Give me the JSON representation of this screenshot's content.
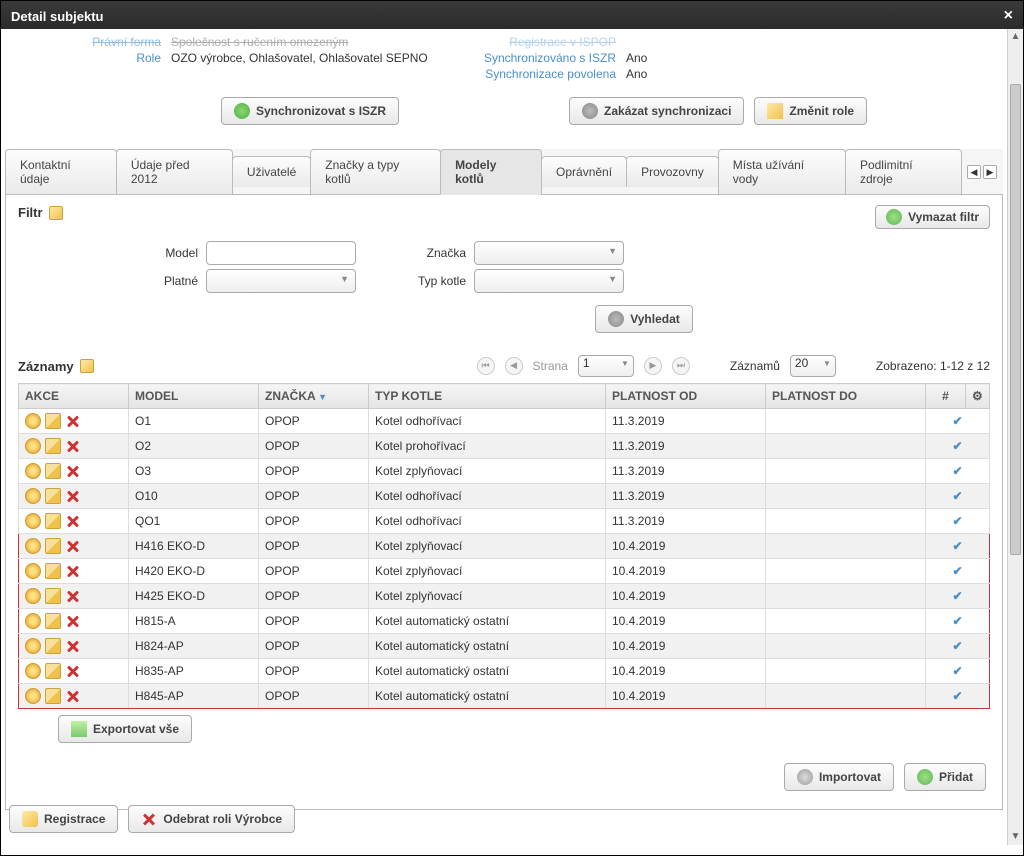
{
  "window": {
    "title": "Detail subjektu"
  },
  "header": {
    "left": [
      {
        "label": "Právní forma",
        "value": "Společnost s ručením omezeným",
        "truncated": true
      },
      {
        "label": "Role",
        "value": "OZO výrobce, Ohlašovatel, Ohlašovatel SEPNO"
      }
    ],
    "right": [
      {
        "label": "Registrace v ISPOP",
        "value": "",
        "truncated": true
      },
      {
        "label": "Synchronizováno s ISZR",
        "value": "Ano"
      },
      {
        "label": "Synchronizace povolena",
        "value": "Ano"
      }
    ]
  },
  "buttons": {
    "sync": "Synchronizovat s ISZR",
    "block": "Zakázat synchronizaci",
    "roles": "Změnit role",
    "export": "Exportovat vše",
    "import": "Importovat",
    "add": "Přidat",
    "registration": "Registrace",
    "removeRole": "Odebrat roli Výrobce",
    "search": "Vyhledat",
    "clear": "Vymazat filtr"
  },
  "tabs": [
    "Kontaktní údaje",
    "Údaje před 2012",
    "Uživatelé",
    "Značky a typy kotlů",
    "Modely kotlů",
    "Oprávnění",
    "Provozovny",
    "Místa užívání vody",
    "Podlimitní zdroje"
  ],
  "activeTab": 4,
  "filter": {
    "title": "Filtr",
    "model_label": "Model",
    "model_value": "",
    "platne_label": "Platné",
    "platne_value": "",
    "znacka_label": "Značka",
    "znacka_value": "",
    "typ_label": "Typ kotle",
    "typ_value": ""
  },
  "records": {
    "title": "Záznamy",
    "page_label": "Strana",
    "page_value": "1",
    "count_label": "Záznamů",
    "count_value": "20",
    "shown": "Zobrazeno: 1-12 z 12"
  },
  "columns": [
    "AKCE",
    "MODEL",
    "ZNAČKA",
    "TYP KOTLE",
    "PLATNOST OD",
    "PLATNOST DO",
    "#"
  ],
  "rows": [
    {
      "model": "O1",
      "znacka": "OPOP",
      "typ": "Kotel odhořívací",
      "od": "11.3.2019",
      "do": "",
      "hl": false
    },
    {
      "model": "O2",
      "znacka": "OPOP",
      "typ": "Kotel prohořívací",
      "od": "11.3.2019",
      "do": "",
      "hl": false
    },
    {
      "model": "O3",
      "znacka": "OPOP",
      "typ": "Kotel zplyňovací",
      "od": "11.3.2019",
      "do": "",
      "hl": false
    },
    {
      "model": "O10",
      "znacka": "OPOP",
      "typ": "Kotel odhořívací",
      "od": "11.3.2019",
      "do": "",
      "hl": false
    },
    {
      "model": "QO1",
      "znacka": "OPOP",
      "typ": "Kotel odhořívací",
      "od": "11.3.2019",
      "do": "",
      "hl": false
    },
    {
      "model": "H416 EKO-D",
      "znacka": "OPOP",
      "typ": "Kotel zplyňovací",
      "od": "10.4.2019",
      "do": "",
      "hl": true
    },
    {
      "model": "H420 EKO-D",
      "znacka": "OPOP",
      "typ": "Kotel zplyňovací",
      "od": "10.4.2019",
      "do": "",
      "hl": true
    },
    {
      "model": "H425 EKO-D",
      "znacka": "OPOP",
      "typ": "Kotel zplyňovací",
      "od": "10.4.2019",
      "do": "",
      "hl": true
    },
    {
      "model": "H815-A",
      "znacka": "OPOP",
      "typ": "Kotel automatický ostatní",
      "od": "10.4.2019",
      "do": "",
      "hl": true
    },
    {
      "model": "H824-AP",
      "znacka": "OPOP",
      "typ": "Kotel automatický ostatní",
      "od": "10.4.2019",
      "do": "",
      "hl": true
    },
    {
      "model": "H835-AP",
      "znacka": "OPOP",
      "typ": "Kotel automatický ostatní",
      "od": "10.4.2019",
      "do": "",
      "hl": true
    },
    {
      "model": "H845-AP",
      "znacka": "OPOP",
      "typ": "Kotel automatický ostatní",
      "od": "10.4.2019",
      "do": "",
      "hl": true
    }
  ]
}
